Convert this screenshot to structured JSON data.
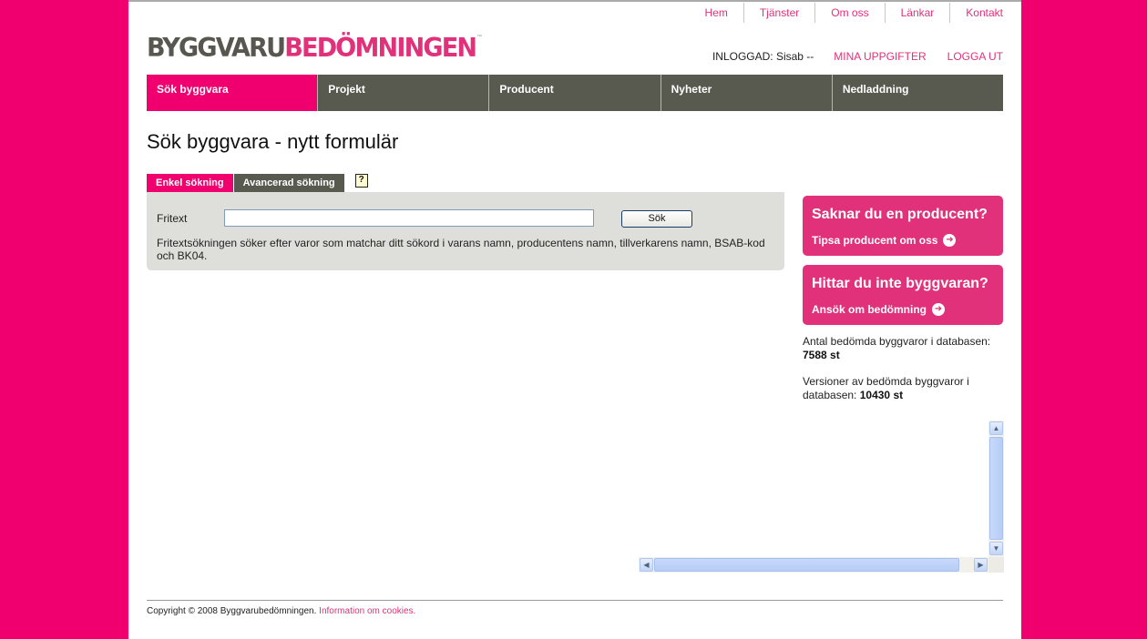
{
  "toplinks": [
    "Hem",
    "Tjänster",
    "Om oss",
    "Länkar",
    "Kontakt"
  ],
  "logo": {
    "part1": "BYGGVARU",
    "part2": "BEDÖMNINGEN",
    "tm": "™"
  },
  "user": {
    "logged_in": "INLOGGAD: Sisab --",
    "mina": "MINA UPPGIFTER",
    "logout": "LOGGA UT"
  },
  "nav": [
    "Sök byggvara",
    "Projekt",
    "Producent",
    "Nyheter",
    "Nedladdning"
  ],
  "page_title": "Sök byggvara - nytt formulär",
  "tabs": {
    "simple": "Enkel sökning",
    "advanced": "Avancerad sökning",
    "help": "?"
  },
  "search": {
    "label": "Fritext",
    "value": "",
    "button": "Sök",
    "description": "Fritextsökningen söker efter varor som matchar ditt sökord i varans namn, producentens namn, tillverkarens namn, BSAB-kod och BK04."
  },
  "box1": {
    "title": "Saknar du en producent?",
    "link": "Tipsa producent om oss"
  },
  "box2": {
    "title": "Hittar du inte byggvaran?",
    "link": "Ansök om bedömning"
  },
  "stats": {
    "count_label": "Antal bedömda byggvaror i databasen:",
    "count_value": "7588 st",
    "versions_label": "Versioner av bedömda byggvaror i databasen:",
    "versions_value": "10430 st"
  },
  "footer": {
    "copyright": "Copyright © 2008 Byggvarubedömningen.",
    "cookies": "Information om cookies."
  },
  "colors": {
    "brand_pink": "#f0006e",
    "link_pink": "#e0317a",
    "nav_grey": "#585a4f"
  }
}
